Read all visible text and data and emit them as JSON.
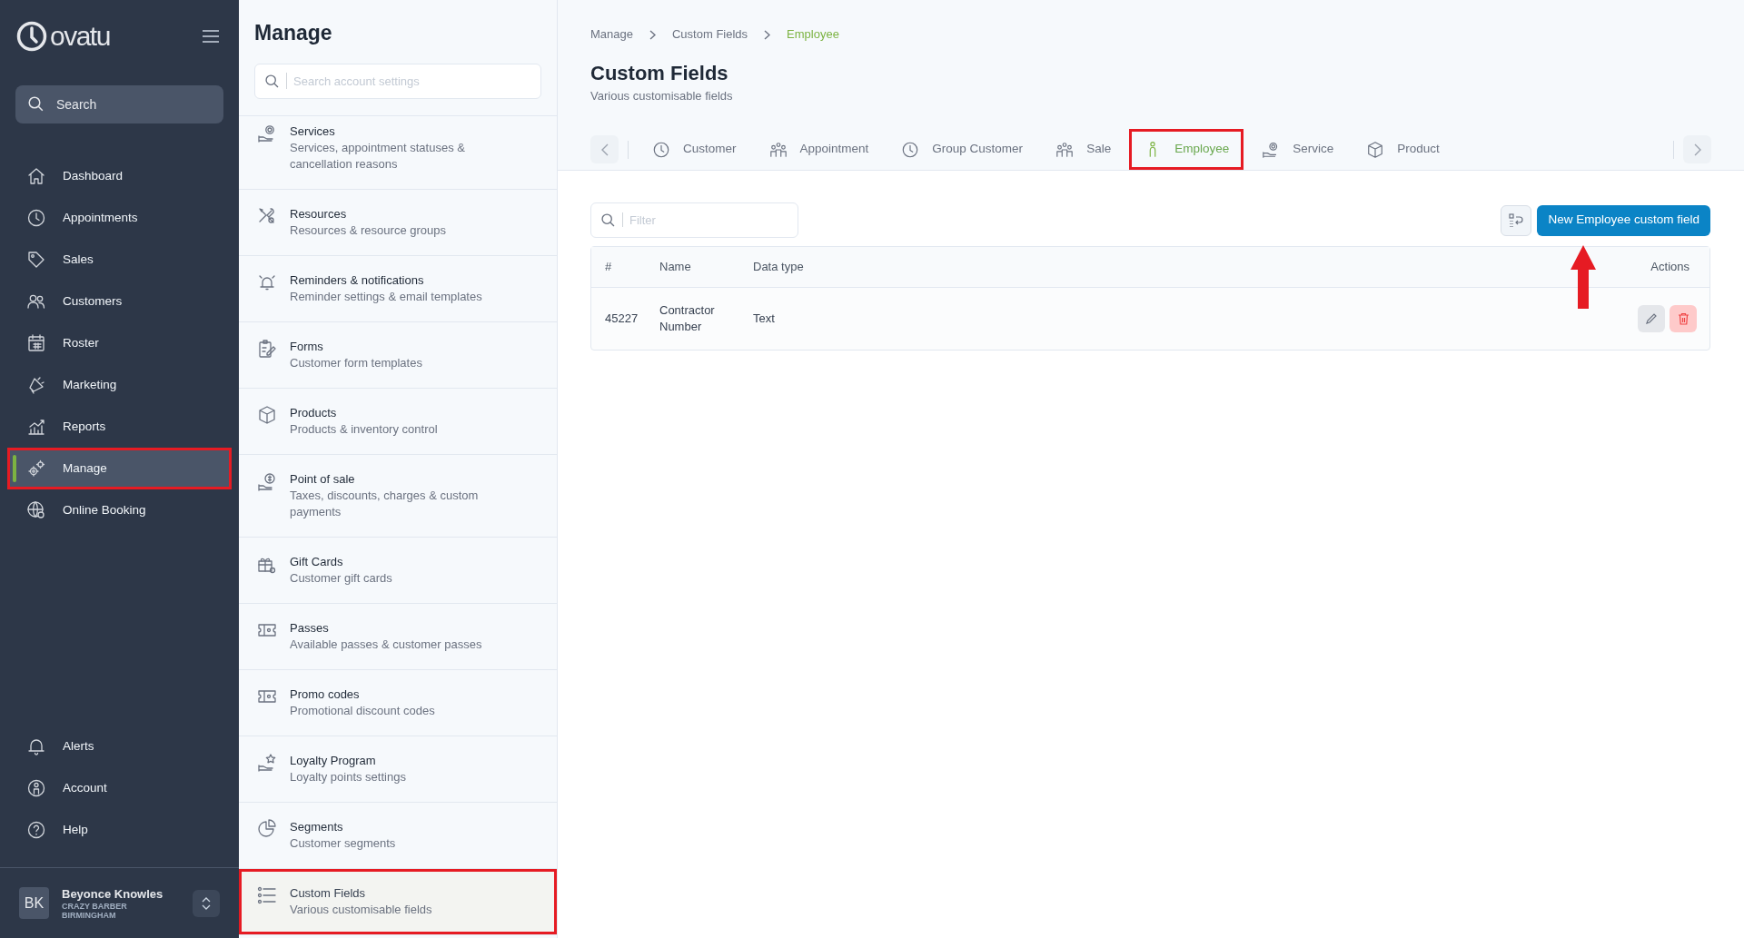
{
  "sidebar": {
    "logo": "ovatu",
    "search": {
      "placeholder": "Search"
    },
    "items": [
      {
        "label": "Dashboard",
        "selected": false,
        "annotated": false
      },
      {
        "label": "Appointments",
        "selected": false,
        "annotated": false
      },
      {
        "label": "Sales",
        "selected": false,
        "annotated": false
      },
      {
        "label": "Customers",
        "selected": false,
        "annotated": false
      },
      {
        "label": "Roster",
        "selected": false,
        "annotated": false
      },
      {
        "label": "Marketing",
        "selected": false,
        "annotated": false
      },
      {
        "label": "Reports",
        "selected": false,
        "annotated": false
      },
      {
        "label": "Manage",
        "selected": true,
        "annotated": true
      },
      {
        "label": "Online Booking",
        "selected": false,
        "annotated": false
      }
    ],
    "footer_items": [
      {
        "label": "Alerts"
      },
      {
        "label": "Account"
      },
      {
        "label": "Help"
      }
    ],
    "user": {
      "initials": "BK",
      "name": "Beyonce Knowles",
      "business": "CRAZY BARBER BIRMINGHAM"
    }
  },
  "settings_panel": {
    "title": "Manage",
    "search": {
      "placeholder": "Search account settings"
    },
    "items": [
      {
        "title": "Services",
        "description": "Services, appointment statuses & cancellation reasons",
        "selected": false,
        "annotated": false
      },
      {
        "title": "Resources",
        "description": "Resources & resource groups",
        "selected": false,
        "annotated": false
      },
      {
        "title": "Reminders & notifications",
        "description": "Reminder settings & email templates",
        "selected": false,
        "annotated": false
      },
      {
        "title": "Forms",
        "description": "Customer form templates",
        "selected": false,
        "annotated": false
      },
      {
        "title": "Products",
        "description": "Products & inventory control",
        "selected": false,
        "annotated": false
      },
      {
        "title": "Point of sale",
        "description": "Taxes, discounts, charges & custom payments",
        "selected": false,
        "annotated": false
      },
      {
        "title": "Gift Cards",
        "description": "Customer gift cards",
        "selected": false,
        "annotated": false
      },
      {
        "title": "Passes",
        "description": "Available passes & customer passes",
        "selected": false,
        "annotated": false
      },
      {
        "title": "Promo codes",
        "description": "Promotional discount codes",
        "selected": false,
        "annotated": false
      },
      {
        "title": "Loyalty Program",
        "description": "Loyalty points settings",
        "selected": false,
        "annotated": false
      },
      {
        "title": "Segments",
        "description": "Customer segments",
        "selected": false,
        "annotated": false
      },
      {
        "title": "Custom Fields",
        "description": "Various customisable fields",
        "selected": true,
        "annotated": true
      }
    ]
  },
  "breadcrumb": [
    "Manage",
    "Custom Fields",
    "Employee"
  ],
  "page": {
    "title": "Custom Fields",
    "subtitle": "Various customisable fields"
  },
  "tabs": [
    {
      "label": "Customer",
      "selected": false,
      "annotated": false
    },
    {
      "label": "Appointment",
      "selected": false,
      "annotated": false
    },
    {
      "label": "Group Customer",
      "selected": false,
      "annotated": false
    },
    {
      "label": "Sale",
      "selected": false,
      "annotated": false
    },
    {
      "label": "Employee",
      "selected": true,
      "annotated": true
    },
    {
      "label": "Service",
      "selected": false,
      "annotated": false
    },
    {
      "label": "Product",
      "selected": false,
      "annotated": false
    }
  ],
  "filter": {
    "placeholder": "Filter"
  },
  "new_button": {
    "label": "New Employee custom field",
    "annotation_arrow": true
  },
  "table": {
    "columns": [
      "#",
      "Name",
      "Data type",
      "Actions"
    ],
    "rows": [
      {
        "cells": [
          "45227",
          "Contractor Number",
          "Text"
        ]
      }
    ]
  }
}
